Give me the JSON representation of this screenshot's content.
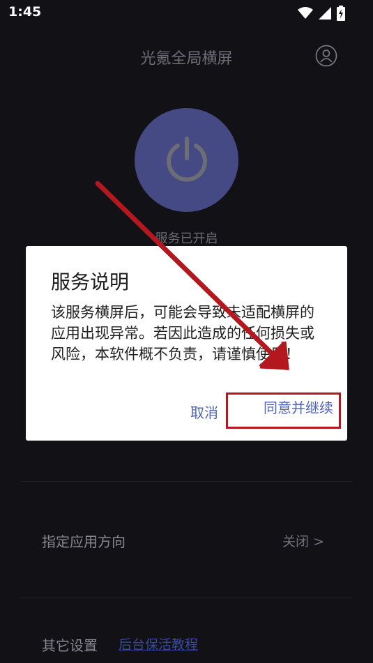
{
  "status_bar": {
    "time": "1:45"
  },
  "header": {
    "title": "光氪全局横屏"
  },
  "power": {
    "status_text": "服务已开启"
  },
  "settings": {
    "orientation": {
      "label": "指定应用方向",
      "value": "关闭 >"
    },
    "other": {
      "label": "其它设置",
      "link": "后台保活教程"
    }
  },
  "dialog": {
    "title": "服务说明",
    "body": "该服务横屏后，可能会导致未适配横屏的应用出现异常。若因此造成的任何损失或风险，本软件概不负责，请谨慎使用！",
    "cancel_label": "取消",
    "agree_label": "同意并继续"
  },
  "colors": {
    "background": "#121116",
    "power_circle": "#454a85",
    "dialog_button": "#5065b8",
    "annotation": "#b3181f"
  }
}
